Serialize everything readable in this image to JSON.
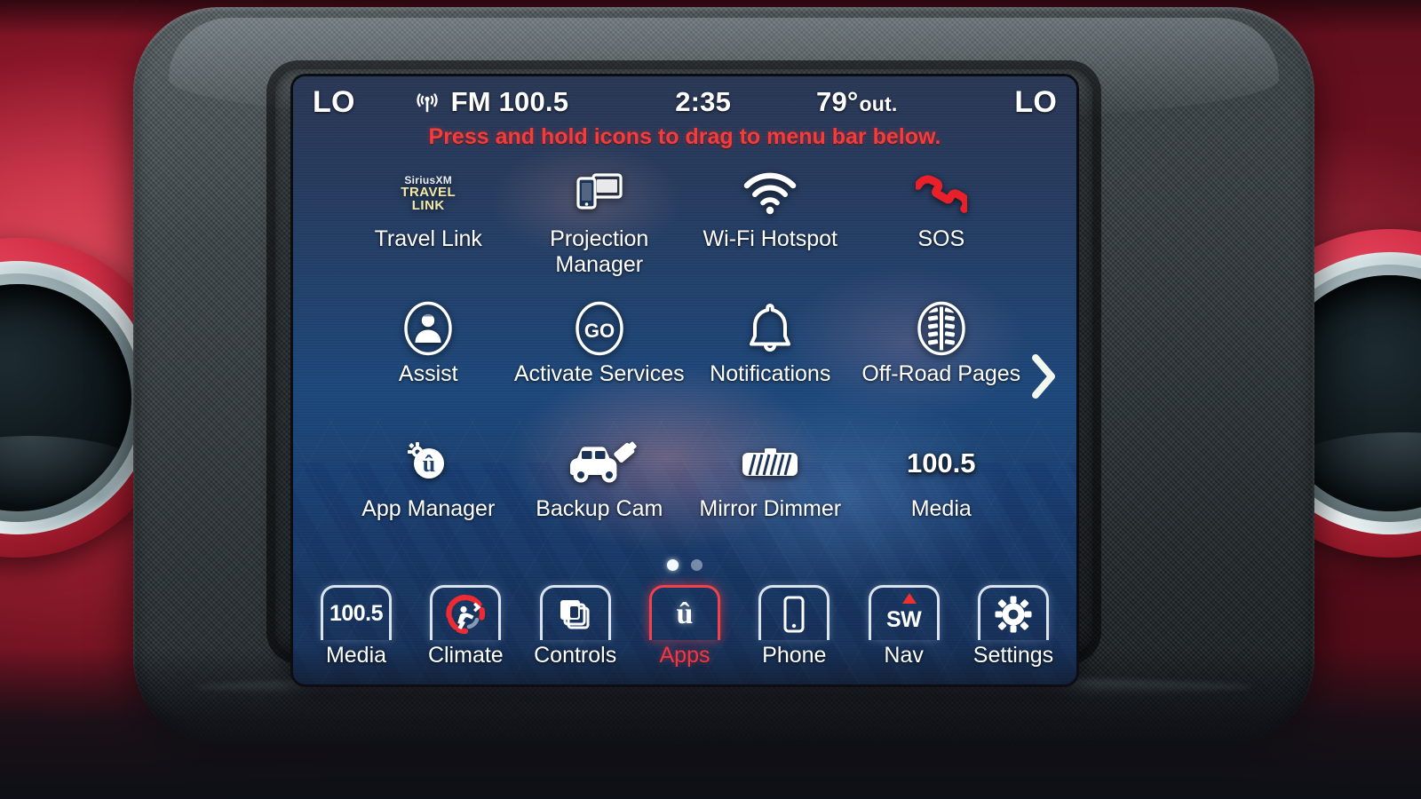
{
  "status_bar": {
    "temp_left_label": "LO",
    "temp_right_label": "LO",
    "radio_source": "FM 100.5",
    "clock": "2:35",
    "outside_temp": "79°",
    "outside_temp_unit": "out.",
    "rds_icon": "radio-broadcast-icon"
  },
  "hint": {
    "text": "Press and hold icons to drag to menu bar below.",
    "color": "#f43c3c"
  },
  "apps": {
    "items": [
      {
        "label": "Travel Link",
        "icon": "siriusxm-travel-link-icon",
        "logo_line1": "SiriusXM",
        "logo_line2": "TRAVEL",
        "logo_line3": "LINK"
      },
      {
        "label": "Projection\nManager",
        "label_line1": "Projection",
        "label_line2": "Manager",
        "icon": "phone-tablet-projection-icon"
      },
      {
        "label": "Wi-Fi Hotspot",
        "icon": "wifi-icon"
      },
      {
        "label": "SOS",
        "icon": "red-phone-handset-icon"
      },
      {
        "label": "Assist",
        "icon": "person-in-circle-icon"
      },
      {
        "label": "Activate Services",
        "icon": "go-circle-icon",
        "icon_text": "GO"
      },
      {
        "label": "Notifications",
        "icon": "bell-icon"
      },
      {
        "label": "Off-Road Pages",
        "icon": "tire-tread-circle-icon"
      },
      {
        "label": "App Manager",
        "icon": "uconnect-gear-icon",
        "icon_text": "û"
      },
      {
        "label": "Backup Cam",
        "icon": "jeep-rear-camera-icon"
      },
      {
        "label": "Mirror Dimmer",
        "icon": "mirror-icon"
      },
      {
        "label": "Media",
        "icon": "media-frequency-text",
        "icon_text": "100.5"
      }
    ]
  },
  "pagination": {
    "next_icon": "chevron-right-icon",
    "dots": 2,
    "active_dot": 0
  },
  "menu_bar": {
    "items": [
      {
        "label": "Media",
        "icon": "radio-frequency-tile",
        "tile_text": "100.5",
        "active": false
      },
      {
        "label": "Climate",
        "icon": "climate-fan-icon",
        "active": false
      },
      {
        "label": "Controls",
        "icon": "stacked-panels-icon",
        "active": false
      },
      {
        "label": "Apps",
        "icon": "uconnect-logo-icon",
        "tile_text": "û",
        "active": true
      },
      {
        "label": "Phone",
        "icon": "smartphone-icon",
        "active": false
      },
      {
        "label": "Nav",
        "icon": "nav-sw-icon",
        "tile_text": "SW",
        "active": false
      },
      {
        "label": "Settings",
        "icon": "gear-icon",
        "active": false
      }
    ]
  },
  "theme": {
    "accent_red": "#f6363f",
    "screen_blue_top": "#2c3a58",
    "screen_blue_mid": "#1f4a7e",
    "dash_red": "#b71e33",
    "text_white": "#ffffff"
  }
}
